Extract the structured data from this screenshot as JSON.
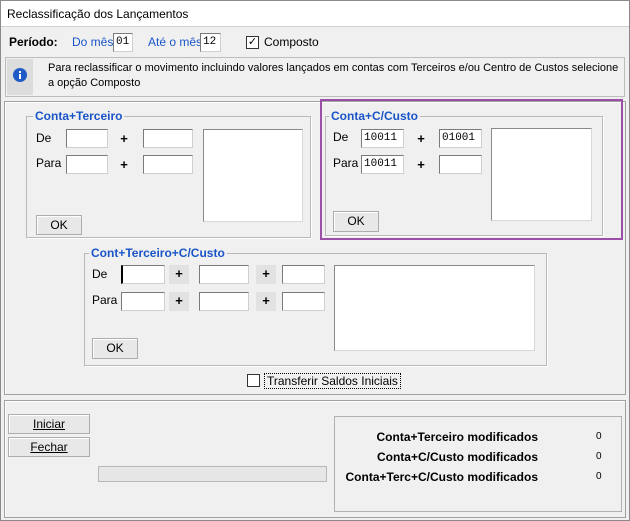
{
  "window": {
    "title": "Reclassificação dos Lançamentos"
  },
  "period": {
    "label": "Período:",
    "from_label": "Do mês",
    "from_value": "01",
    "to_label": "Até o mês",
    "to_value": "12",
    "composto_label": "Composto",
    "composto_checked": "✓"
  },
  "info": {
    "icon": "info-icon",
    "text": "Para reclassificar o movimento incluindo valores lançados em contas com Terceiros e/ou Centro de Custos selecione a opção Composto"
  },
  "conta_terceiro": {
    "title": "Conta+Terceiro",
    "de_label": "De",
    "para_label": "Para",
    "plus": "+",
    "de_conta": "",
    "de_terceiro": "",
    "para_conta": "",
    "para_terceiro": "",
    "ok_label": "OK"
  },
  "conta_ccusto": {
    "title": "Conta+C/Custo",
    "de_label": "De",
    "para_label": "Para",
    "plus": "+",
    "de_conta": "10011",
    "de_ccusto": "01001",
    "para_conta": "10011",
    "para_ccusto": "",
    "ok_label": "OK",
    "highlight_color": "#9b4fa8"
  },
  "cont_terceiro_ccusto": {
    "title": "Cont+Terceiro+C/Custo",
    "de_label": "De",
    "para_label": "Para",
    "plus": "+",
    "ok_label": "OK"
  },
  "transferir_label": "Transferir Saldos Iniciais",
  "buttons": {
    "iniciar": "Iniciar",
    "fechar": "Fechar"
  },
  "stats": [
    {
      "label": "Conta+Terceiro modificados",
      "value": "0"
    },
    {
      "label": "Conta+C/Custo modificados",
      "value": "0"
    },
    {
      "label": "Conta+Terc+C/Custo modificados",
      "value": "0"
    }
  ],
  "progress": {
    "value": 0
  }
}
